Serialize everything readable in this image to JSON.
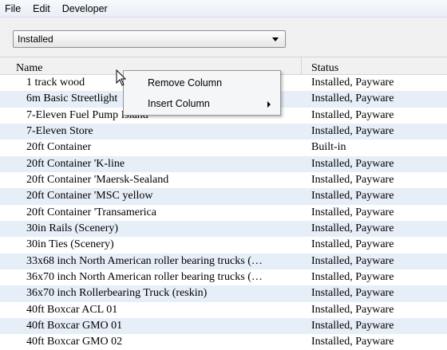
{
  "menubar": {
    "items": [
      "File",
      "Edit",
      "Developer"
    ]
  },
  "filter": {
    "selected": "Installed"
  },
  "table": {
    "columns": [
      "Name",
      "Status"
    ],
    "rows": [
      {
        "name": "1 track wood",
        "status": "Installed, Payware"
      },
      {
        "name": "6m Basic Streetlight",
        "status": "Installed, Payware"
      },
      {
        "name": "7-Eleven Fuel Pump Island",
        "status": "Installed, Payware"
      },
      {
        "name": "7-Eleven Store",
        "status": "Installed, Payware"
      },
      {
        "name": "20ft Container",
        "status": "Built-in"
      },
      {
        "name": "20ft Container 'K-line",
        "status": "Installed, Payware"
      },
      {
        "name": "20ft Container 'Maersk-Sealand",
        "status": "Installed, Payware"
      },
      {
        "name": "20ft Container 'MSC yellow",
        "status": "Installed, Payware"
      },
      {
        "name": "20ft Container 'Transamerica",
        "status": "Installed, Payware"
      },
      {
        "name": "30in Rails (Scenery)",
        "status": "Installed, Payware"
      },
      {
        "name": "30in Ties (Scenery)",
        "status": "Installed, Payware"
      },
      {
        "name": "33x68 inch North American roller bearing trucks (…",
        "status": "Installed, Payware"
      },
      {
        "name": "36x70 inch North American roller bearing trucks (…",
        "status": "Installed, Payware"
      },
      {
        "name": "36x70 inch Rollerbearing Truck (reskin)",
        "status": "Installed, Payware"
      },
      {
        "name": "40ft Boxcar ACL 01",
        "status": "Installed, Payware"
      },
      {
        "name": "40ft Boxcar GMO 01",
        "status": "Installed, Payware"
      },
      {
        "name": "40ft Boxcar GMO 02",
        "status": "Installed, Payware"
      }
    ]
  },
  "context_menu": {
    "items": [
      "Remove Column",
      "Insert Column"
    ]
  },
  "icons": {
    "dropdown": "chevron-down-icon",
    "submenu": "chevron-right-icon",
    "cursor": "mouse-cursor-icon"
  }
}
